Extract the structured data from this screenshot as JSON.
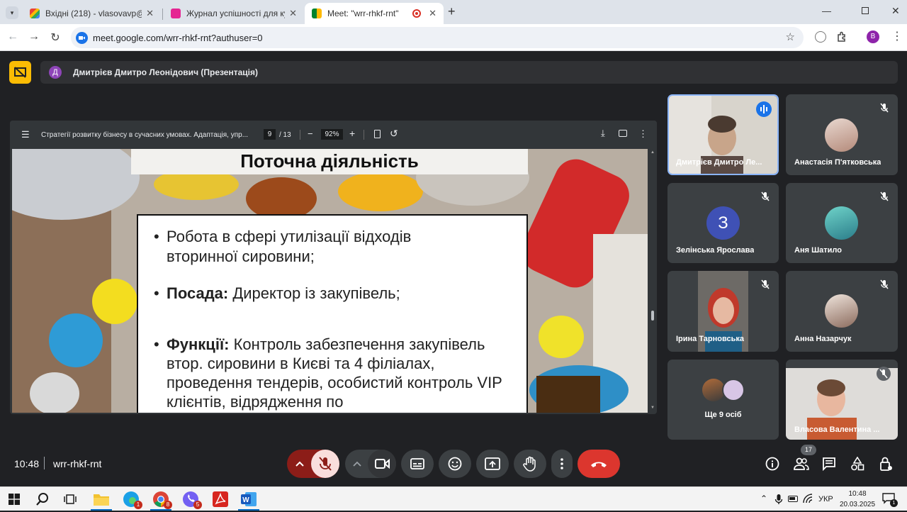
{
  "browser": {
    "tabs": [
      {
        "title": "Вхідні (218) - vlasovavp@gsuite",
        "icon": "gmail-icon",
        "active": false
      },
      {
        "title": "Журнал успішності для курсу \"",
        "icon": "classroom-icon",
        "active": false
      },
      {
        "title": "Meet: \"wrr-rhkf-rnt\"",
        "icon": "meet-icon",
        "active": true
      }
    ],
    "url": "meet.google.com/wrr-rhkf-rnt?authuser=0",
    "profile_letter": "B"
  },
  "meet": {
    "presenter_initial": "Д",
    "presenter_title": "Дмитрієв Дмитро Леонідович (Презентація)",
    "pdf": {
      "doc_title": "Стратегії розвитку бізнесу в сучасних умовах. Адаптація, упр...",
      "page_current": "9",
      "page_total": "/ 13",
      "zoom": "92%"
    },
    "slide": {
      "heading": "Поточна діяльність",
      "bullet1": "Робота в сфері утилізації відходів вторинної сировини;",
      "bullet2_bold": "Посада:",
      "bullet2_text": " Директор із закупівель;",
      "bullet3_bold": "Функції:",
      "bullet3_text": " Контроль забезпечення закупівель втор. сировини в Києві та 4 філіалах, проведення тендерів, особистий контроль VIP клієнтів, відрядження по"
    },
    "participants": [
      {
        "name": "Дмитрієв Дмитро Ле...",
        "speaking": true
      },
      {
        "name": "Анастасія П'ятковська"
      },
      {
        "name": "Зелінська Ярослава",
        "initial": "З"
      },
      {
        "name": "Аня Шатило"
      },
      {
        "name": "Ірина Тарновська"
      },
      {
        "name": "Анна Назарчук"
      },
      {
        "name": "Ще 9 осіб"
      },
      {
        "name": "Власова Валентина ..."
      }
    ],
    "time": "10:48",
    "meeting_code": "wrr-rhkf-rnt",
    "participant_count": "17"
  },
  "taskbar": {
    "lang": "УКР",
    "clock_time": "10:48",
    "clock_date": "20.03.2025",
    "badges": {
      "edge": "1",
      "chrome": "8",
      "viber": "5"
    },
    "notif_count": "1"
  }
}
